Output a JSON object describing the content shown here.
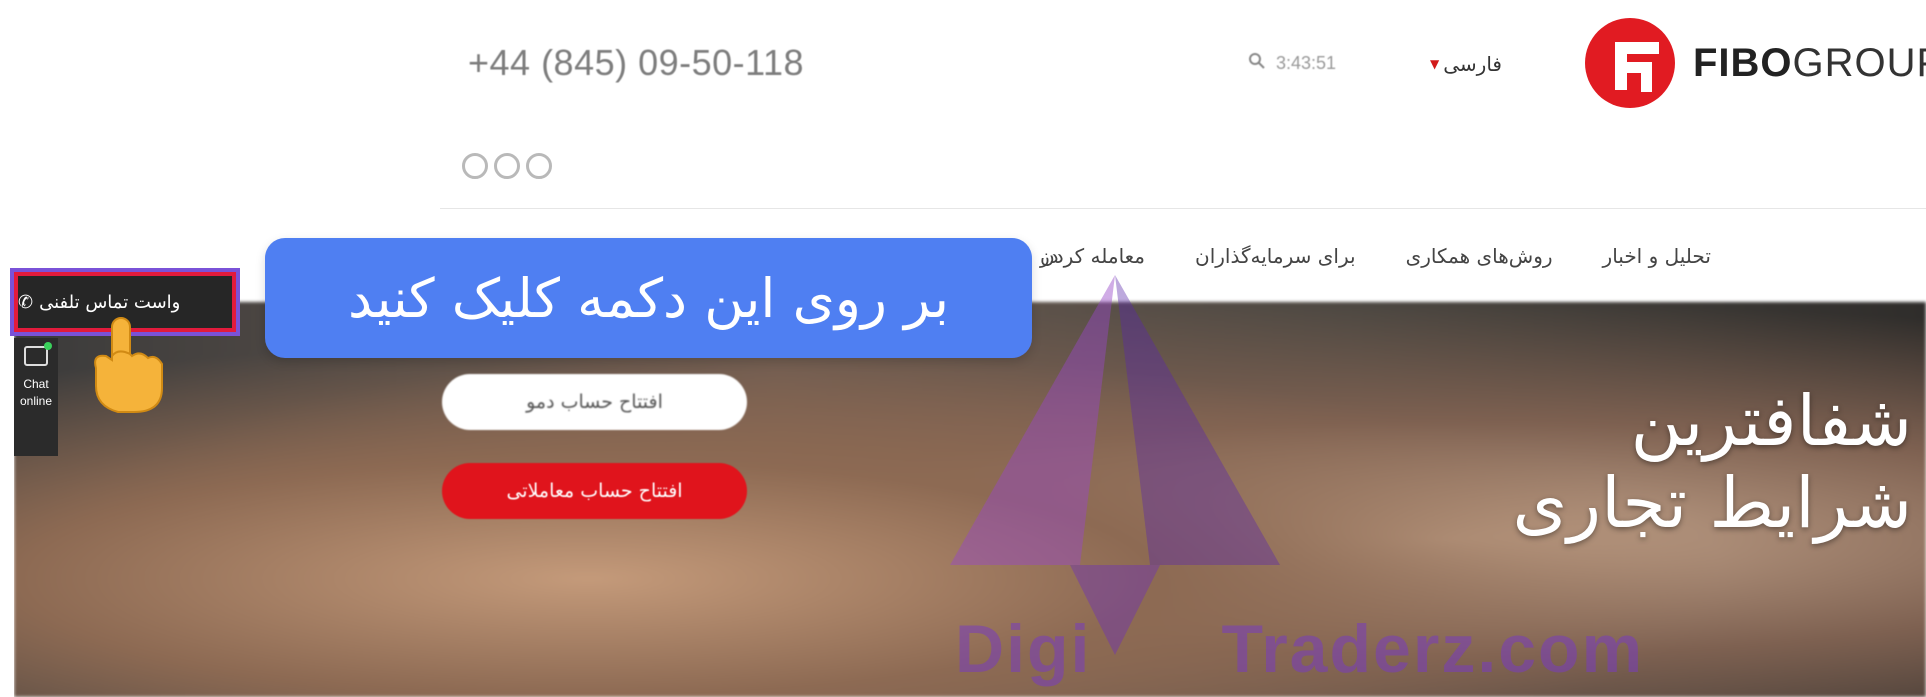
{
  "header": {
    "phone": "+44 (845) 09-50-118",
    "time": "3:43:51",
    "language": "فارسی",
    "logo_bold": "FIBO",
    "logo_rest": "GROUP"
  },
  "nav": {
    "items": [
      "معامله کردن",
      "برای سرمایه‌گذاران",
      "روش‌های همکاری",
      "تحلیل و اخبار"
    ],
    "cut_item": "در"
  },
  "hero": {
    "title_line1": "شفافترین",
    "title_line2": "شرایط تجاری",
    "demo_button": "افتتاح حساب دمو",
    "real_button": "افتتاح حساب معاملاتی"
  },
  "side": {
    "callback_label": "واست تماس تلفنی",
    "chat_label_1": "Chat",
    "chat_label_2": "online"
  },
  "overlay": {
    "tooltip": "بر روی این دکمه کلیک کنید",
    "watermark_left": "Digi",
    "watermark_right": "Traderz.com"
  },
  "colors": {
    "accent_red": "#e11b22",
    "tooltip_blue": "#4f7ff2",
    "highlight_red": "#e21b3c",
    "highlight_purple": "#7a52d8"
  },
  "icons": {
    "search": "search-icon",
    "phone": "phone-icon",
    "chat": "chat-icon",
    "hand": "pointing-hand-icon",
    "social": [
      "facebook-icon",
      "youtube-icon",
      "telegram-icon"
    ]
  }
}
